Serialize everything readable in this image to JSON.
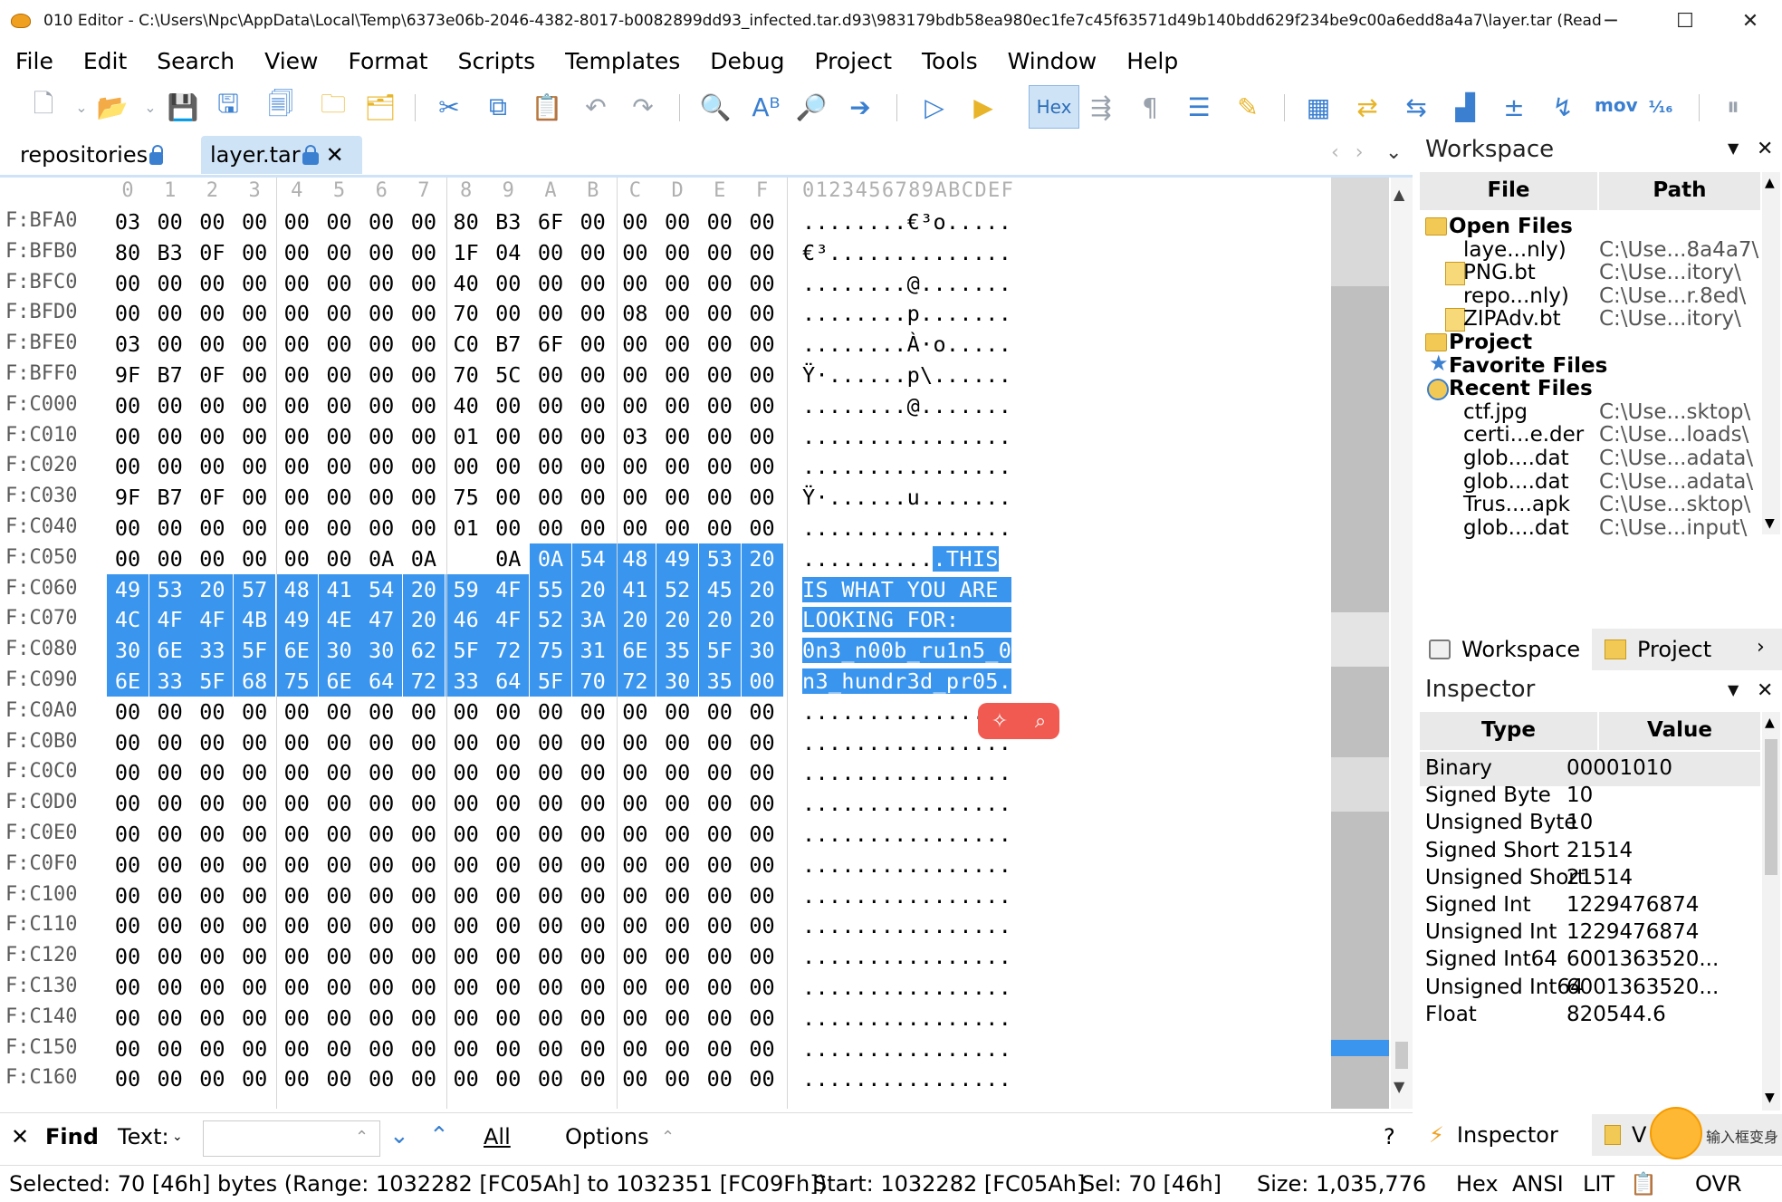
{
  "window": {
    "title": "010 Editor - C:\\Users\\Npc\\AppData\\Local\\Temp\\6373e06b-2046-4382-8017-b0082899dd93_infected.tar.d93\\983179bdb58ea980ec1fe7c45f63571d49b140bdd629f234be9c00a6edd8a4a7\\layer.tar (Read Only)",
    "minimize": "─",
    "maximize": "☐",
    "close": "✕"
  },
  "menu": [
    "File",
    "Edit",
    "Search",
    "View",
    "Format",
    "Scripts",
    "Templates",
    "Debug",
    "Project",
    "Tools",
    "Window",
    "Help"
  ],
  "toolbar": {
    "hex_label": "Hex",
    "mov_label": "mov",
    "icons": [
      "new-file-icon",
      "open-file-icon",
      "save-icon",
      "save-as-icon",
      "save-all-icon",
      "open-folder-icon",
      "open-project-icon",
      "cut-icon",
      "copy-icon",
      "paste-icon",
      "undo-icon",
      "redo-icon",
      "find-icon",
      "replace-icon",
      "find-in-files-icon",
      "goto-icon",
      "run-script-icon",
      "run-template-icon",
      "whitespace-icon",
      "paragraph-icon",
      "columns-icon",
      "highlight-icon",
      "calculator-icon",
      "compare-icon",
      "checksum-icon",
      "histogram-icon",
      "base-converter-icon",
      "disassembler-icon",
      "number-base-icon",
      "pause-icon"
    ]
  },
  "tabs": [
    {
      "label": "repositories",
      "active": false
    },
    {
      "label": "layer.tar",
      "active": true
    }
  ],
  "hex": {
    "column_headers": [
      "0",
      "1",
      "2",
      "3",
      "4",
      "5",
      "6",
      "7",
      "8",
      "9",
      "A",
      "B",
      "C",
      "D",
      "E",
      "F"
    ],
    "ascii_header": "0123456789ABCDEF",
    "rows": [
      {
        "addr": "F:BFA0",
        "bytes": [
          "03",
          "00",
          "00",
          "00",
          "00",
          "00",
          "00",
          "00",
          "80",
          "B3",
          "6F",
          "00",
          "00",
          "00",
          "00",
          "00"
        ],
        "ascii": "........€³o....."
      },
      {
        "addr": "F:BFB0",
        "bytes": [
          "80",
          "B3",
          "0F",
          "00",
          "00",
          "00",
          "00",
          "00",
          "1F",
          "04",
          "00",
          "00",
          "00",
          "00",
          "00",
          "00"
        ],
        "ascii": "€³.............."
      },
      {
        "addr": "F:BFC0",
        "bytes": [
          "00",
          "00",
          "00",
          "00",
          "00",
          "00",
          "00",
          "00",
          "40",
          "00",
          "00",
          "00",
          "00",
          "00",
          "00",
          "00"
        ],
        "ascii": "........@......."
      },
      {
        "addr": "F:BFD0",
        "bytes": [
          "00",
          "00",
          "00",
          "00",
          "00",
          "00",
          "00",
          "00",
          "70",
          "00",
          "00",
          "00",
          "08",
          "00",
          "00",
          "00"
        ],
        "ascii": "........p......."
      },
      {
        "addr": "F:BFE0",
        "bytes": [
          "03",
          "00",
          "00",
          "00",
          "00",
          "00",
          "00",
          "00",
          "C0",
          "B7",
          "6F",
          "00",
          "00",
          "00",
          "00",
          "00"
        ],
        "ascii": "........À·o....."
      },
      {
        "addr": "F:BFF0",
        "bytes": [
          "9F",
          "B7",
          "0F",
          "00",
          "00",
          "00",
          "00",
          "00",
          "70",
          "5C",
          "00",
          "00",
          "00",
          "00",
          "00",
          "00"
        ],
        "ascii": "Ÿ·......p\\......"
      },
      {
        "addr": "F:C000",
        "bytes": [
          "00",
          "00",
          "00",
          "00",
          "00",
          "00",
          "00",
          "00",
          "40",
          "00",
          "00",
          "00",
          "00",
          "00",
          "00",
          "00"
        ],
        "ascii": "........@......."
      },
      {
        "addr": "F:C010",
        "bytes": [
          "00",
          "00",
          "00",
          "00",
          "00",
          "00",
          "00",
          "00",
          "01",
          "00",
          "00",
          "00",
          "03",
          "00",
          "00",
          "00"
        ],
        "ascii": "................"
      },
      {
        "addr": "F:C020",
        "bytes": [
          "00",
          "00",
          "00",
          "00",
          "00",
          "00",
          "00",
          "00",
          "00",
          "00",
          "00",
          "00",
          "00",
          "00",
          "00",
          "00"
        ],
        "ascii": "................"
      },
      {
        "addr": "F:C030",
        "bytes": [
          "9F",
          "B7",
          "0F",
          "00",
          "00",
          "00",
          "00",
          "00",
          "75",
          "00",
          "00",
          "00",
          "00",
          "00",
          "00",
          "00"
        ],
        "ascii": "Ÿ·......u......."
      },
      {
        "addr": "F:C040",
        "bytes": [
          "00",
          "00",
          "00",
          "00",
          "00",
          "00",
          "00",
          "00",
          "01",
          "00",
          "00",
          "00",
          "00",
          "00",
          "00",
          "00"
        ],
        "ascii": "................"
      },
      {
        "addr": "F:C050",
        "bytes": [
          "00",
          "00",
          "00",
          "00",
          "00",
          "00",
          "0A",
          "0A",
          "0A",
          "0A",
          "54",
          "48",
          "49",
          "53",
          "20"
        ],
        "ascii": "..........",
        "ascii_sel": ".THIS"
      },
      {
        "addr": "F:C060",
        "bytes": [
          "49",
          "53",
          "20",
          "57",
          "48",
          "41",
          "54",
          "20",
          "59",
          "4F",
          "55",
          "20",
          "41",
          "52",
          "45",
          "20"
        ],
        "ascii": "",
        "ascii_sel": "IS WHAT YOU ARE "
      },
      {
        "addr": "F:C070",
        "bytes": [
          "4C",
          "4F",
          "4F",
          "4B",
          "49",
          "4E",
          "47",
          "20",
          "46",
          "4F",
          "52",
          "3A",
          "20",
          "20",
          "20",
          "20"
        ],
        "ascii": "",
        "ascii_sel": "LOOKING FOR:    "
      },
      {
        "addr": "F:C080",
        "bytes": [
          "30",
          "6E",
          "33",
          "5F",
          "6E",
          "30",
          "30",
          "62",
          "5F",
          "72",
          "75",
          "31",
          "6E",
          "35",
          "5F",
          "30"
        ],
        "ascii": "",
        "ascii_sel": "0n3_n00b_ru1n5_0"
      },
      {
        "addr": "F:C090",
        "bytes": [
          "6E",
          "33",
          "5F",
          "68",
          "75",
          "6E",
          "64",
          "72",
          "33",
          "64",
          "5F",
          "70",
          "72",
          "30",
          "35",
          "00"
        ],
        "ascii": "",
        "ascii_sel": "n3_hundr3d_pr05."
      },
      {
        "addr": "F:C0A0",
        "bytes": [
          "00",
          "00",
          "00",
          "00",
          "00",
          "00",
          "00",
          "00",
          "00",
          "00",
          "00",
          "00",
          "00",
          "00",
          "00",
          "00"
        ],
        "ascii": "................"
      },
      {
        "addr": "F:C0B0",
        "bytes": [
          "00",
          "00",
          "00",
          "00",
          "00",
          "00",
          "00",
          "00",
          "00",
          "00",
          "00",
          "00",
          "00",
          "00",
          "00",
          "00"
        ],
        "ascii": "................"
      },
      {
        "addr": "F:C0C0",
        "bytes": [
          "00",
          "00",
          "00",
          "00",
          "00",
          "00",
          "00",
          "00",
          "00",
          "00",
          "00",
          "00",
          "00",
          "00",
          "00",
          "00"
        ],
        "ascii": "................"
      },
      {
        "addr": "F:C0D0",
        "bytes": [
          "00",
          "00",
          "00",
          "00",
          "00",
          "00",
          "00",
          "00",
          "00",
          "00",
          "00",
          "00",
          "00",
          "00",
          "00",
          "00"
        ],
        "ascii": "................"
      },
      {
        "addr": "F:C0E0",
        "bytes": [
          "00",
          "00",
          "00",
          "00",
          "00",
          "00",
          "00",
          "00",
          "00",
          "00",
          "00",
          "00",
          "00",
          "00",
          "00",
          "00"
        ],
        "ascii": "................"
      },
      {
        "addr": "F:C0F0",
        "bytes": [
          "00",
          "00",
          "00",
          "00",
          "00",
          "00",
          "00",
          "00",
          "00",
          "00",
          "00",
          "00",
          "00",
          "00",
          "00",
          "00"
        ],
        "ascii": "................"
      },
      {
        "addr": "F:C100",
        "bytes": [
          "00",
          "00",
          "00",
          "00",
          "00",
          "00",
          "00",
          "00",
          "00",
          "00",
          "00",
          "00",
          "00",
          "00",
          "00",
          "00"
        ],
        "ascii": "................"
      },
      {
        "addr": "F:C110",
        "bytes": [
          "00",
          "00",
          "00",
          "00",
          "00",
          "00",
          "00",
          "00",
          "00",
          "00",
          "00",
          "00",
          "00",
          "00",
          "00",
          "00"
        ],
        "ascii": "................"
      },
      {
        "addr": "F:C120",
        "bytes": [
          "00",
          "00",
          "00",
          "00",
          "00",
          "00",
          "00",
          "00",
          "00",
          "00",
          "00",
          "00",
          "00",
          "00",
          "00",
          "00"
        ],
        "ascii": "................"
      },
      {
        "addr": "F:C130",
        "bytes": [
          "00",
          "00",
          "00",
          "00",
          "00",
          "00",
          "00",
          "00",
          "00",
          "00",
          "00",
          "00",
          "00",
          "00",
          "00",
          "00"
        ],
        "ascii": "................"
      },
      {
        "addr": "F:C140",
        "bytes": [
          "00",
          "00",
          "00",
          "00",
          "00",
          "00",
          "00",
          "00",
          "00",
          "00",
          "00",
          "00",
          "00",
          "00",
          "00",
          "00"
        ],
        "ascii": "................"
      },
      {
        "addr": "F:C150",
        "bytes": [
          "00",
          "00",
          "00",
          "00",
          "00",
          "00",
          "00",
          "00",
          "00",
          "00",
          "00",
          "00",
          "00",
          "00",
          "00",
          "00"
        ],
        "ascii": "................"
      },
      {
        "addr": "F:C160",
        "bytes": [
          "00",
          "00",
          "00",
          "00",
          "00",
          "00",
          "00",
          "00",
          "00",
          "00",
          "00",
          "00",
          "00",
          "00",
          "00",
          "00"
        ],
        "ascii": "................"
      }
    ]
  },
  "workspace": {
    "title": "Workspace",
    "col_file": "File",
    "col_path": "Path",
    "items": [
      {
        "name": "Open Files",
        "path": "",
        "kind": "category"
      },
      {
        "name": "laye...nly)",
        "path": "C:\\Use...8a4a7\\",
        "kind": "file"
      },
      {
        "name": "PNG.bt",
        "path": "C:\\Use...itory\\",
        "kind": "template"
      },
      {
        "name": "repo...nly)",
        "path": "C:\\Use...r.8ed\\",
        "kind": "file"
      },
      {
        "name": "ZIPAdv.bt",
        "path": "C:\\Use...itory\\",
        "kind": "template"
      },
      {
        "name": "Project",
        "path": "",
        "kind": "category"
      },
      {
        "name": "Favorite Files",
        "path": "",
        "kind": "category"
      },
      {
        "name": "Recent Files",
        "path": "",
        "kind": "category"
      },
      {
        "name": "ctf.jpg",
        "path": "C:\\Use...sktop\\",
        "kind": "file"
      },
      {
        "name": "certi...e.der",
        "path": "C:\\Use...loads\\",
        "kind": "file"
      },
      {
        "name": "glob....dat",
        "path": "C:\\Use...adata\\",
        "kind": "file"
      },
      {
        "name": "glob....dat",
        "path": "C:\\Use...adata\\",
        "kind": "file"
      },
      {
        "name": "Trus....apk",
        "path": "C:\\Use...sktop\\",
        "kind": "file"
      },
      {
        "name": "glob....dat",
        "path": "C:\\Use...input\\",
        "kind": "file"
      }
    ],
    "tab_workspace": "Workspace",
    "tab_project": "Project"
  },
  "inspector": {
    "title": "Inspector",
    "col_type": "Type",
    "col_value": "Value",
    "rows": [
      {
        "type": "Binary",
        "value": "00001010"
      },
      {
        "type": "Signed Byte",
        "value": "10"
      },
      {
        "type": "Unsigned Byte",
        "value": "10"
      },
      {
        "type": "Signed Short",
        "value": "21514"
      },
      {
        "type": "Unsigned Short",
        "value": "21514"
      },
      {
        "type": "Signed Int",
        "value": "1229476874"
      },
      {
        "type": "Unsigned Int",
        "value": "1229476874"
      },
      {
        "type": "Signed Int64",
        "value": "6001363520..."
      },
      {
        "type": "Unsigned Int64",
        "value": "6001363520..."
      },
      {
        "type": "Float",
        "value": "820544.6"
      }
    ],
    "tab_inspector": "Inspector",
    "tab_variables": "V"
  },
  "find": {
    "label": "Find",
    "text_label": "Text:",
    "text_value": "",
    "all_label": "All",
    "options_label": "Options",
    "help": "?"
  },
  "status": {
    "selected": "Selected: 70 [46h] bytes (Range: 1032282 [FC05Ah] to 1032351 [FC09Fh])",
    "start": "Start: 1032282 [FC05Ah]",
    "sel": "Sel: 70 [46h]",
    "size": "Size: 1,035,776",
    "mode": "Hex",
    "charset": "ANSI",
    "endian": "LIT",
    "insert": "OVR"
  },
  "ime": {
    "text": "输入框变身"
  }
}
